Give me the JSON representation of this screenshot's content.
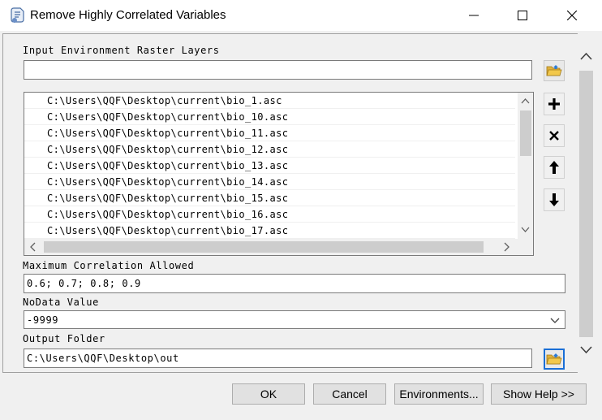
{
  "window": {
    "title": "Remove Highly Correlated Variables",
    "minimize_glyph": "—",
    "maximize_glyph": "☐",
    "close_glyph": "✕"
  },
  "input_layers": {
    "label": "Input Environment Raster Layers",
    "value": "",
    "items": [
      "C:\\Users\\QQF\\Desktop\\current\\bio_1.asc",
      "C:\\Users\\QQF\\Desktop\\current\\bio_10.asc",
      "C:\\Users\\QQF\\Desktop\\current\\bio_11.asc",
      "C:\\Users\\QQF\\Desktop\\current\\bio_12.asc",
      "C:\\Users\\QQF\\Desktop\\current\\bio_13.asc",
      "C:\\Users\\QQF\\Desktop\\current\\bio_14.asc",
      "C:\\Users\\QQF\\Desktop\\current\\bio_15.asc",
      "C:\\Users\\QQF\\Desktop\\current\\bio_16.asc",
      "C:\\Users\\QQF\\Desktop\\current\\bio_17.asc"
    ]
  },
  "max_corr": {
    "label": "Maximum Correlation Allowed",
    "value": "0.6; 0.7; 0.8; 0.9"
  },
  "nodata": {
    "label": "NoData Value",
    "value": "-9999"
  },
  "output": {
    "label": "Output Folder",
    "value": "C:\\Users\\QQF\\Desktop\\out"
  },
  "buttons": {
    "ok": "OK",
    "cancel": "Cancel",
    "environments": "Environments...",
    "show_help": "Show Help >>"
  },
  "colors": {
    "focus_border": "#1a6fd6",
    "folder_yellow": "#f2c84b"
  }
}
